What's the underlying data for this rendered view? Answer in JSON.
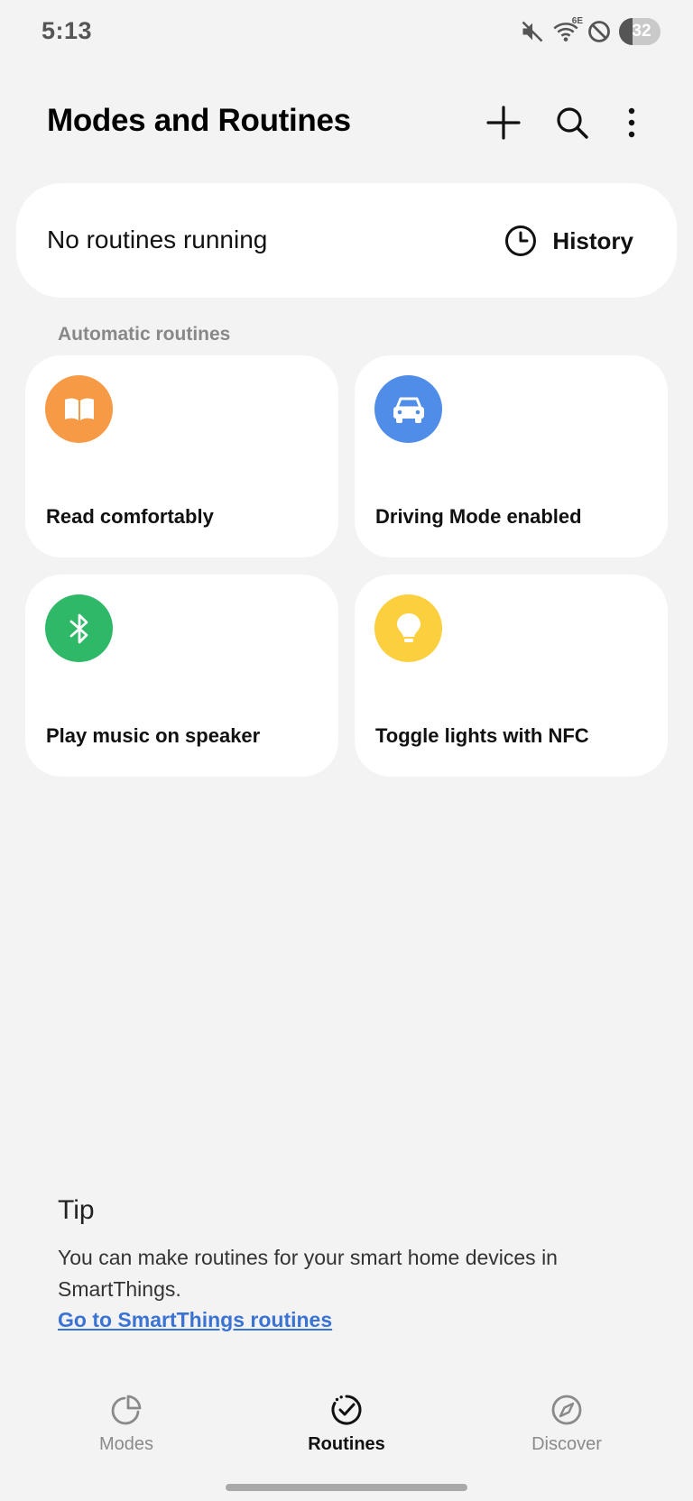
{
  "status_bar": {
    "time": "5:13",
    "network": "6E",
    "battery_level": "32",
    "battery_fraction": 0.32,
    "icons": [
      "mute-icon",
      "wifi-icon",
      "do-not-disturb-icon",
      "battery-icon"
    ]
  },
  "header": {
    "title": "Modes and Routines",
    "actions": [
      "add-icon",
      "search-icon",
      "more-options-icon"
    ]
  },
  "running": {
    "text": "No routines running",
    "history_label": "History"
  },
  "section": {
    "label": "Automatic routines"
  },
  "routines": [
    {
      "label": "Read comfortably",
      "icon": "book-icon",
      "color": "#f79a45"
    },
    {
      "label": "Driving Mode enabled",
      "icon": "car-icon",
      "color": "#4f8de8"
    },
    {
      "label": "Play music on speaker",
      "icon": "bluetooth-icon",
      "color": "#2eb867"
    },
    {
      "label": "Toggle lights with NFC",
      "icon": "lightbulb-icon",
      "color": "#fbcf3d"
    }
  ],
  "tip": {
    "title": "Tip",
    "body": "You can make routines for your smart home devices in SmartThings.",
    "link": "Go to SmartThings routines"
  },
  "nav": {
    "modes": "Modes",
    "routines": "Routines",
    "discover": "Discover",
    "active": "routines"
  },
  "colors": {
    "background": "#f3f3f3",
    "card": "#ffffff",
    "link": "#3a73d4"
  }
}
